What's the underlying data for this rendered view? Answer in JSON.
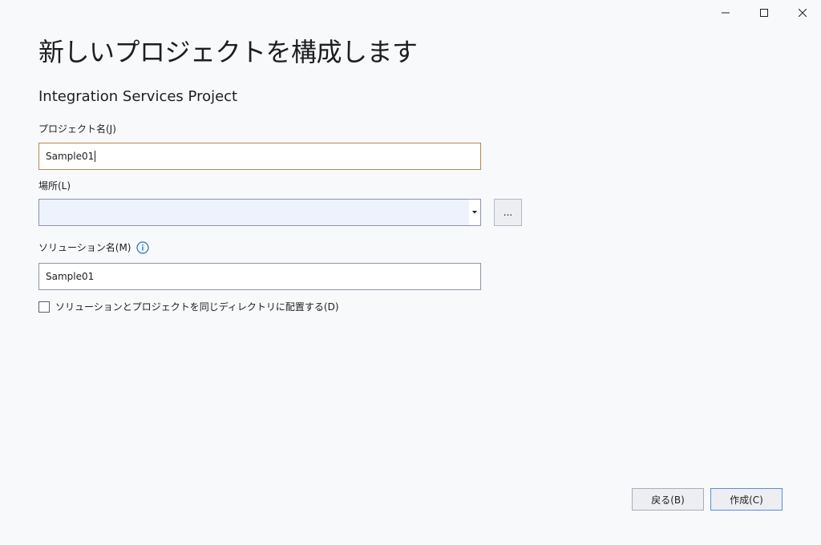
{
  "window": {
    "minimize_icon": "minimize-icon",
    "maximize_icon": "maximize-icon",
    "close_icon": "close-icon"
  },
  "header": {
    "title": "新しいプロジェクトを構成します",
    "subtitle": "Integration Services Project"
  },
  "form": {
    "project_name_label": "プロジェクト名(J)",
    "project_name_value": "Sample01",
    "location_label": "場所(L)",
    "location_value": "",
    "browse_label": "...",
    "solution_name_label": "ソリューション名(M)",
    "solution_name_value": "Sample01",
    "same_dir_label": "ソリューションとプロジェクトを同じディレクトリに配置する(D)",
    "same_dir_checked": false
  },
  "footer": {
    "back_label": "戻る(B)",
    "create_label": "作成(C)"
  },
  "colors": {
    "accent": "#1a73c8",
    "focus_border": "#b08a4a",
    "background": "#f8f9fb"
  }
}
